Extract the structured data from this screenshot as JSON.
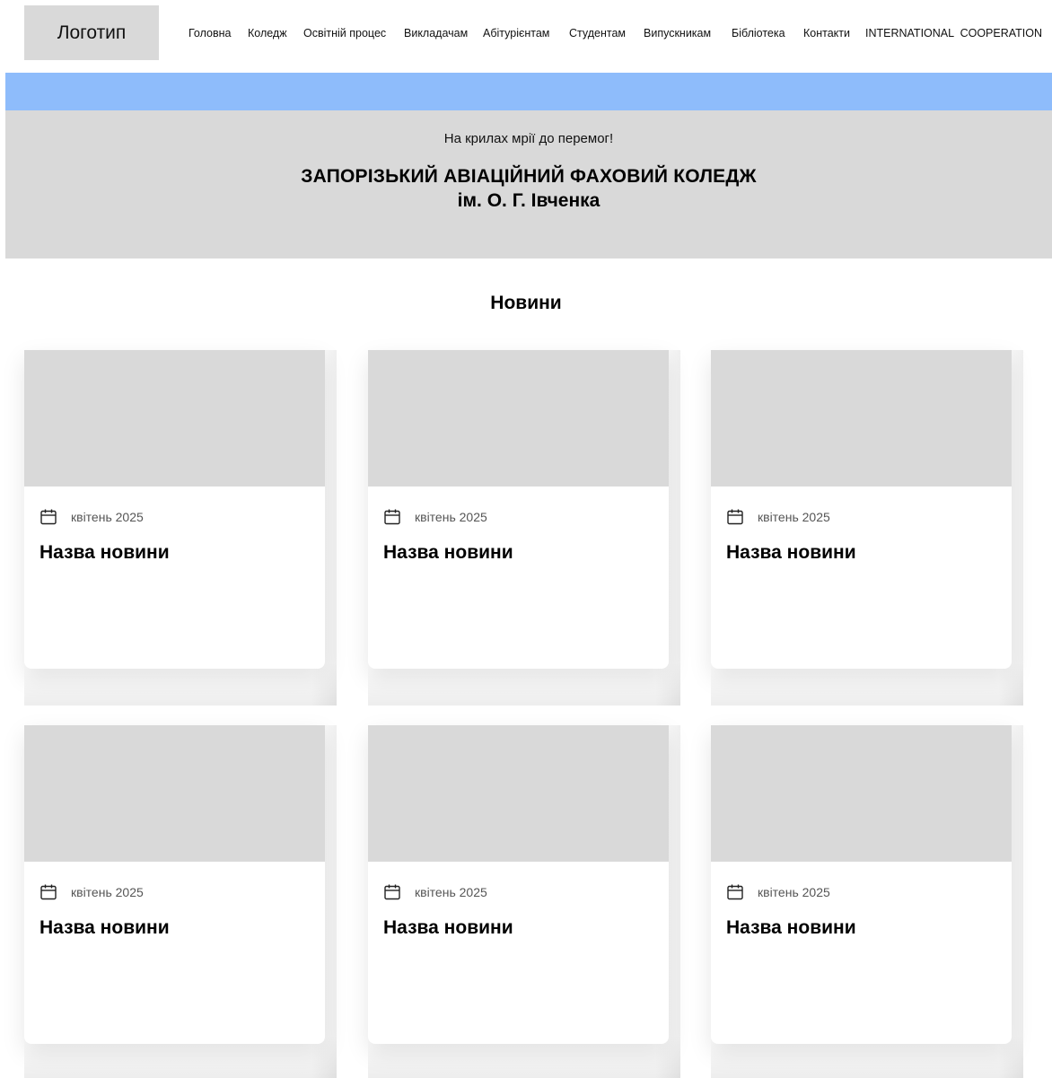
{
  "header": {
    "logo": "Логотип",
    "nav": [
      "Головна",
      "Коледж",
      "Освітній процес",
      "Викладачам",
      "Абітурієнтам",
      "Студентам",
      "Випускникам",
      "Бібліотека",
      "Контакти",
      "INTERNATIONAL  COOPERATION"
    ]
  },
  "colors": {
    "accent_strip": "#8ebcfb",
    "placeholder": "#d9d9d9"
  },
  "hero": {
    "tagline": "На крилах мрії до перемог!",
    "title_line1": "ЗАПОРІЗЬКИЙ АВІАЦІЙНИЙ ФАХОВИЙ КОЛЕДЖ",
    "title_line2": "ім. О. Г. Івченка"
  },
  "news": {
    "heading": "Новини",
    "items": [
      {
        "date": "квітень 2025",
        "title": "Назва новини",
        "icon": "calendar-icon"
      },
      {
        "date": "квітень 2025",
        "title": "Назва новини",
        "icon": "calendar-icon"
      },
      {
        "date": "квітень 2025",
        "title": "Назва новини",
        "icon": "calendar-icon"
      },
      {
        "date": "квітень 2025",
        "title": "Назва новини",
        "icon": "calendar-icon"
      },
      {
        "date": "квітень 2025",
        "title": "Назва новини",
        "icon": "calendar-icon"
      },
      {
        "date": "квітень 2025",
        "title": "Назва новини",
        "icon": "calendar-icon"
      }
    ]
  }
}
